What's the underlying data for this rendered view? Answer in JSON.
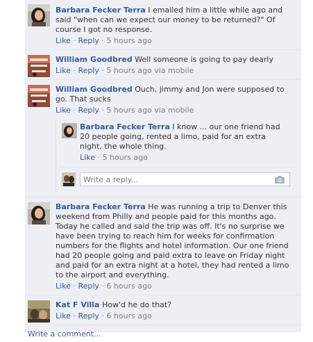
{
  "thread": {
    "comments": [
      {
        "author": "Barbara Fecker Terra",
        "body": "I emailed him a little while ago and said \"when can we expect our money to be returned?\" Of course I got no response.",
        "like": "Like",
        "reply": "Reply",
        "time": "5 hours ago",
        "via": ""
      },
      {
        "author": "William Goodbred",
        "body": "Well someone is going to pay dearly",
        "like": "Like",
        "reply": "Reply",
        "time": "5 hours ago",
        "via": "via mobile"
      },
      {
        "author": "William Goodbred",
        "body": "Ouch, jimmy and Jon were supposed to go. That sucks",
        "like": "Like",
        "reply": "Reply",
        "time": "5 hours ago",
        "via": "via mobile",
        "reply_item": {
          "author": "Barbara Fecker Terra",
          "body": "I know ... our one friend had 20 people going, rented a limo, paid for an extra night, the whole thing.",
          "like": "Like",
          "time": "5 hours ago"
        },
        "reply_placeholder": "Write a reply..."
      },
      {
        "author": "Barbara Fecker Terra",
        "body": "He was running a trip to Denver this weekend from Philly and people paid for this months ago. Today he called and said the trip was off. It's no surprise we have been trying to reach him for weeks for confirmation numbers for the flights and hotel information. Our one friend had 20 people going and paid extra to leave on Friday night and paid for an extra night at a hotel, they had rented a limo to the airport and everything.",
        "like": "Like",
        "reply": "Reply",
        "time": "6 hours ago",
        "via": ""
      },
      {
        "author": "Kat F Villa",
        "body": "How'd he do that?",
        "like": "Like",
        "reply": "Reply",
        "time": "6 hours ago",
        "via": ""
      }
    ],
    "write_comment": "Write a comment...",
    "colors": {
      "link": "#3b5998",
      "background": "#edeff4",
      "meta": "#808080"
    }
  }
}
